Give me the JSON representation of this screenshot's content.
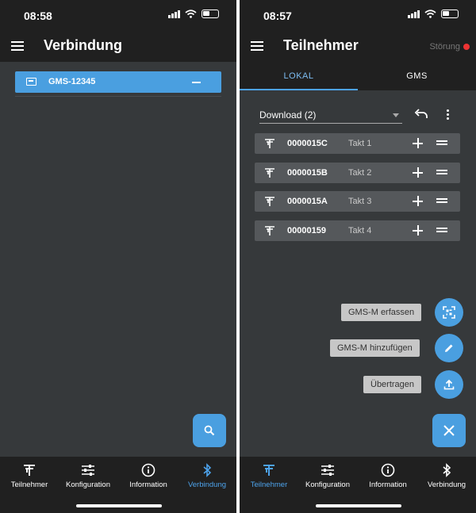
{
  "left": {
    "status": {
      "time": "08:58"
    },
    "appbar": {
      "title": "Verbindung"
    },
    "connection": {
      "label": "GMS-12345"
    },
    "nav": [
      {
        "label": "Teilnehmer"
      },
      {
        "label": "Konfiguration"
      },
      {
        "label": "Information"
      },
      {
        "label": "Verbindung"
      }
    ]
  },
  "right": {
    "status": {
      "time": "08:57"
    },
    "appbar": {
      "title": "Teilnehmer",
      "status": "Störung"
    },
    "tabs": [
      {
        "label": "LOKAL"
      },
      {
        "label": "GMS"
      }
    ],
    "dropdown": {
      "selected": "Download (2)"
    },
    "participants": [
      {
        "id": "0000015C",
        "takt": "Takt 1"
      },
      {
        "id": "0000015B",
        "takt": "Takt 2"
      },
      {
        "id": "0000015A",
        "takt": "Takt 3"
      },
      {
        "id": "00000159",
        "takt": "Takt 4"
      }
    ],
    "fab_actions": [
      {
        "label": "GMS-M erfassen",
        "icon": "qr-scan-icon"
      },
      {
        "label": "GMS-M hinzufügen",
        "icon": "pencil-icon"
      },
      {
        "label": "Übertragen",
        "icon": "upload-icon"
      }
    ],
    "nav": [
      {
        "label": "Teilnehmer"
      },
      {
        "label": "Konfiguration"
      },
      {
        "label": "Information"
      },
      {
        "label": "Verbindung"
      }
    ]
  },
  "colors": {
    "accent": "#4a9fe0",
    "background": "#36393b",
    "bar": "#202020",
    "error": "#ee3333"
  }
}
